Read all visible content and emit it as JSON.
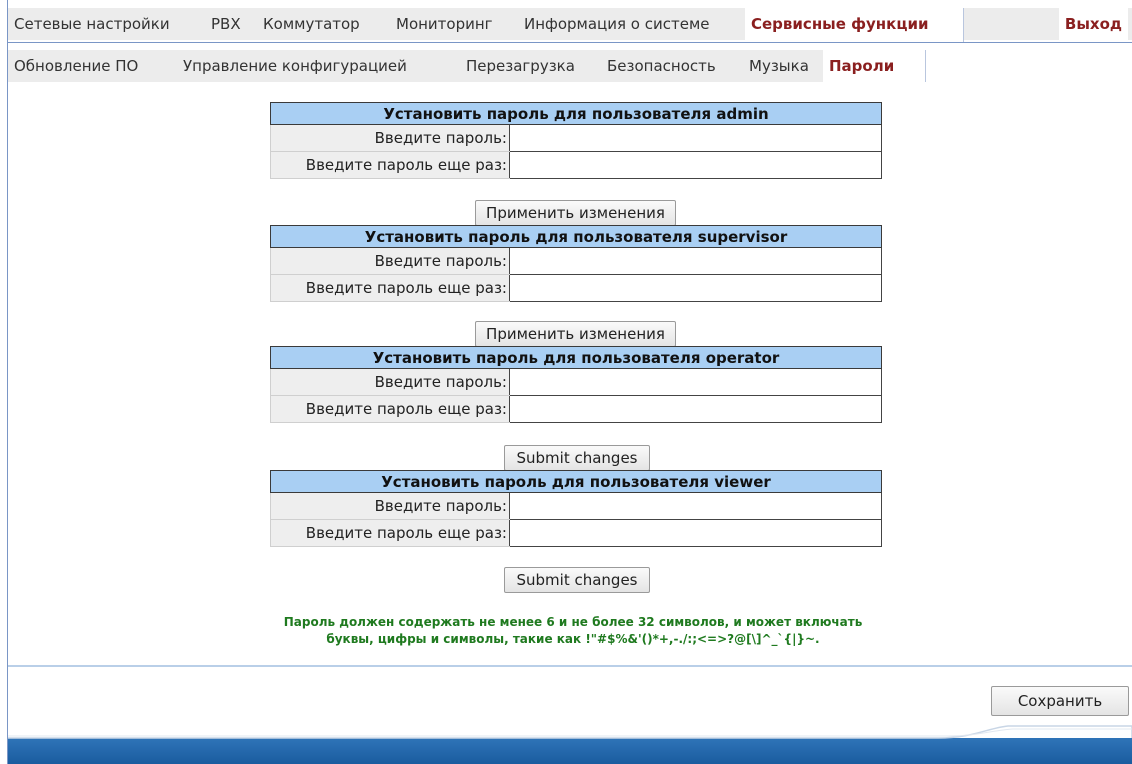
{
  "top_nav": {
    "tabs": [
      "Сетевые настройки",
      "PBX",
      "Коммутатор",
      "Мониторинг",
      "Информация о системе",
      "Сервисные функции"
    ],
    "active": "Сервисные функции",
    "exit_label": "Выход"
  },
  "sub_nav": {
    "tabs": [
      "Обновление ПО",
      "Управление конфигурацией",
      "Перезагрузка",
      "Безопасность",
      "Музыка",
      "Пароли"
    ],
    "active": "Пароли"
  },
  "forms": [
    {
      "title": "Установить пароль для пользователя admin",
      "label1": "Введите пароль:",
      "label2": "Введите пароль еще раз:",
      "button": "Применить изменения"
    },
    {
      "title": "Установить пароль для пользователя supervisor",
      "label1": "Введите пароль:",
      "label2": "Введите пароль еще раз:",
      "button": "Применить изменения"
    },
    {
      "title": "Установить пароль для пользователя operator",
      "label1": "Введите пароль:",
      "label2": "Введите пароль еще раз:",
      "button": "Submit changes"
    },
    {
      "title": "Установить пароль для пользователя viewer",
      "label1": "Введите пароль:",
      "label2": "Введите пароль еще раз:",
      "button": "Submit changes"
    }
  ],
  "note": {
    "line1": "Пароль должен содержать не менее 6 и не более 32 символов, и может включать",
    "line2": "буквы, цифры и символы, такие как !\"#$%&'()*+,-./:;<=>?@[\\]^_`{|}~."
  },
  "save_label": "Сохранить",
  "colors": {
    "active_tab": "#8a1f1f",
    "table_header": "#a9cff3",
    "note": "#1f7a1f",
    "footer": "#1a5c9f"
  }
}
